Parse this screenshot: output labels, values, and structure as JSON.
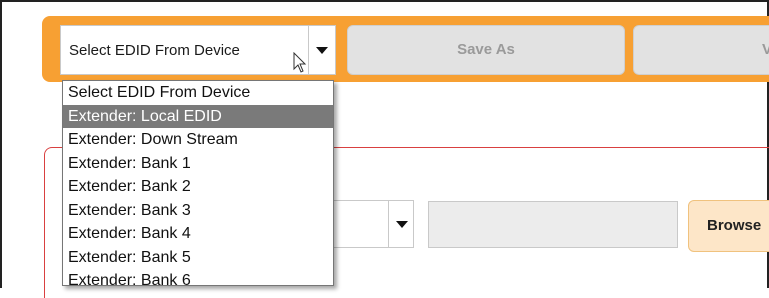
{
  "toolbar": {
    "select_value": "Select EDID From Device",
    "save_as_label": "Save As",
    "view_label": "Vi"
  },
  "dropdown": {
    "items": [
      "Select EDID From Device",
      "Extender: Local EDID",
      "Extender: Down Stream",
      "Extender: Bank 1",
      "Extender: Bank 2",
      "Extender: Bank 3",
      "Extender: Bank 4",
      "Extender: Bank 5",
      "Extender: Bank 6"
    ],
    "selected_index": 1
  },
  "panel": {
    "browse_label": "Browse",
    "file_input_value": ""
  },
  "colors": {
    "toolbar_accent": "#f7a033",
    "panel_border": "#d94040",
    "highlight": "#7a7a7a",
    "browse_bg": "#fde6c8"
  }
}
